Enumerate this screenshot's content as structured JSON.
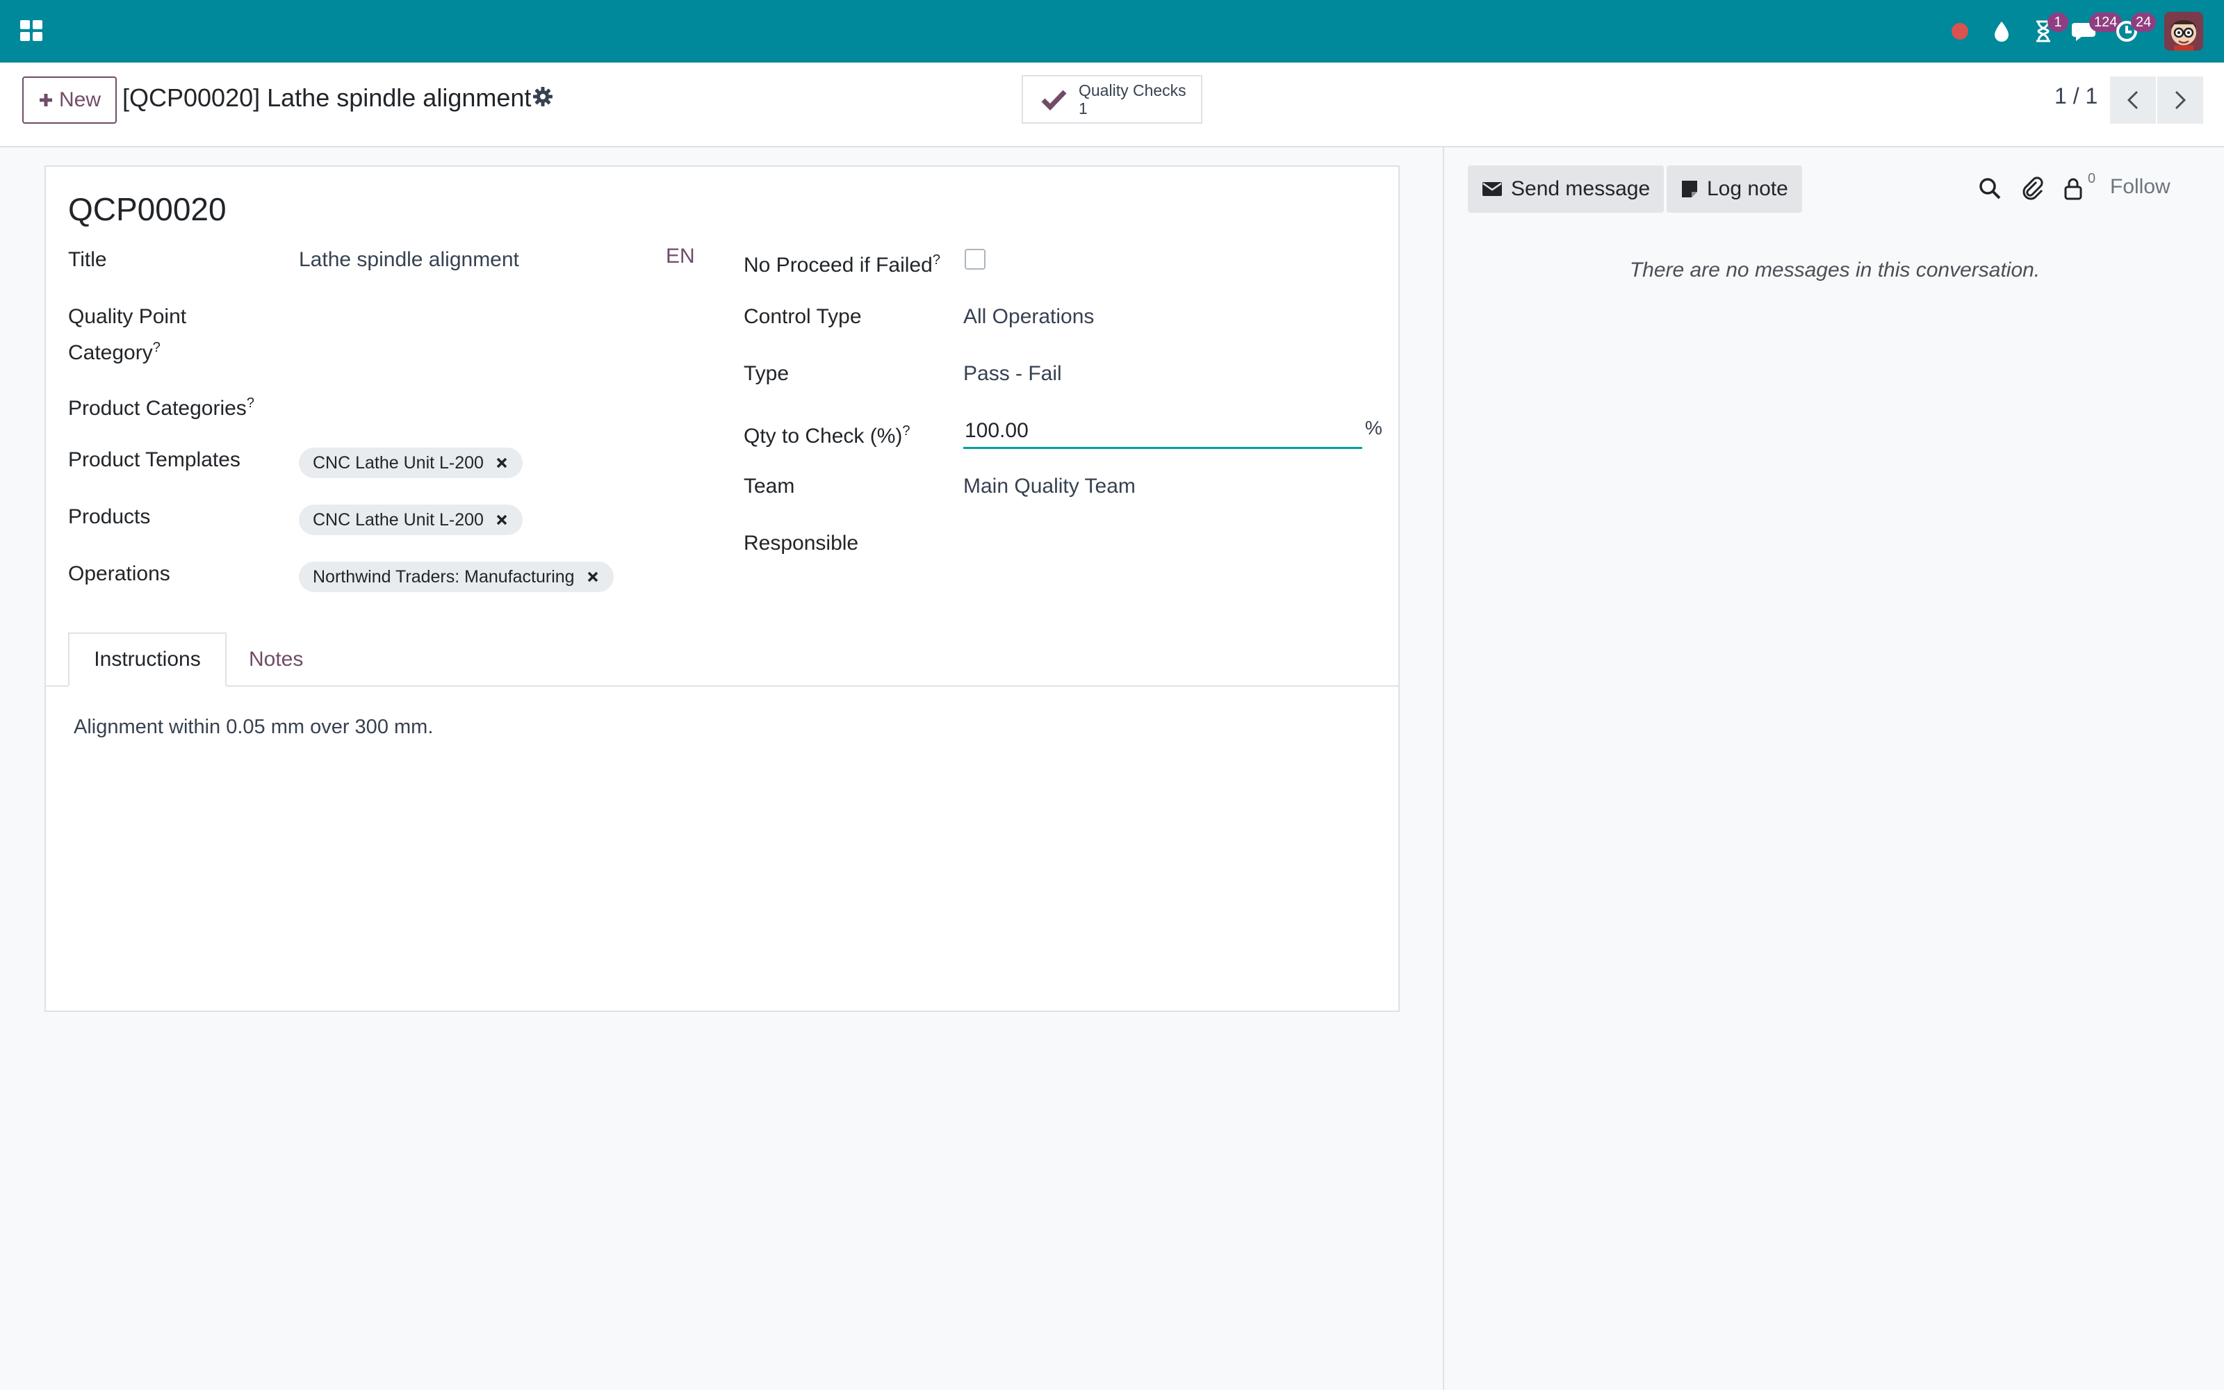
{
  "navbar": {
    "apps_icon": "apps-grid-icon",
    "systray": [
      {
        "name": "recording-dot-icon",
        "badge": ""
      },
      {
        "name": "drop-icon",
        "badge": ""
      },
      {
        "name": "hourglass-icon",
        "badge": "1"
      },
      {
        "name": "chat-icon",
        "badge": "124"
      },
      {
        "name": "activity-icon",
        "badge": "24"
      }
    ]
  },
  "control_panel": {
    "new_label": "New",
    "title": "[QCP00020] Lathe spindle alignment",
    "smart_button": {
      "label": "Quality Checks",
      "count": "1"
    },
    "pager": "1 / 1"
  },
  "form": {
    "reference": "QCP00020",
    "left": {
      "title_label": "Title",
      "title_value": "Lathe spindle alignment",
      "lang": "EN",
      "qp_category_label_1": "Quality Point",
      "qp_category_label_2": "Category",
      "product_categories_label": "Product Categories",
      "product_templates_label": "Product Templates",
      "product_templates_tags": [
        "CNC Lathe Unit L-200"
      ],
      "products_label": "Products",
      "products_tags": [
        "CNC Lathe Unit L-200"
      ],
      "operations_label": "Operations",
      "operations_tags": [
        "Northwind Traders: Manufacturing"
      ]
    },
    "right": {
      "no_proceed_label": "No Proceed if Failed",
      "no_proceed_checked": false,
      "control_type_label": "Control Type",
      "control_type_value": "All Operations",
      "type_label": "Type",
      "type_value": "Pass - Fail",
      "qty_label": "Qty to Check (%)",
      "qty_value": "100.00",
      "qty_unit": "%",
      "team_label": "Team",
      "team_value": "Main Quality Team",
      "responsible_label": "Responsible",
      "responsible_value": ""
    },
    "help_mark": "?",
    "tabs": [
      "Instructions",
      "Notes"
    ],
    "active_tab": "Instructions",
    "instructions_text": "Alignment within 0.05 mm over 300 mm."
  },
  "chatter": {
    "send_message_label": "Send message",
    "log_note_label": "Log note",
    "followers_count": "0",
    "follow_label": "Follow",
    "empty_text": "There are no messages in this conversation."
  },
  "colors": {
    "navbar": "#00889b",
    "brand": "#714b67",
    "badge": "#8f3f81",
    "input_focus": "#00a09d"
  }
}
